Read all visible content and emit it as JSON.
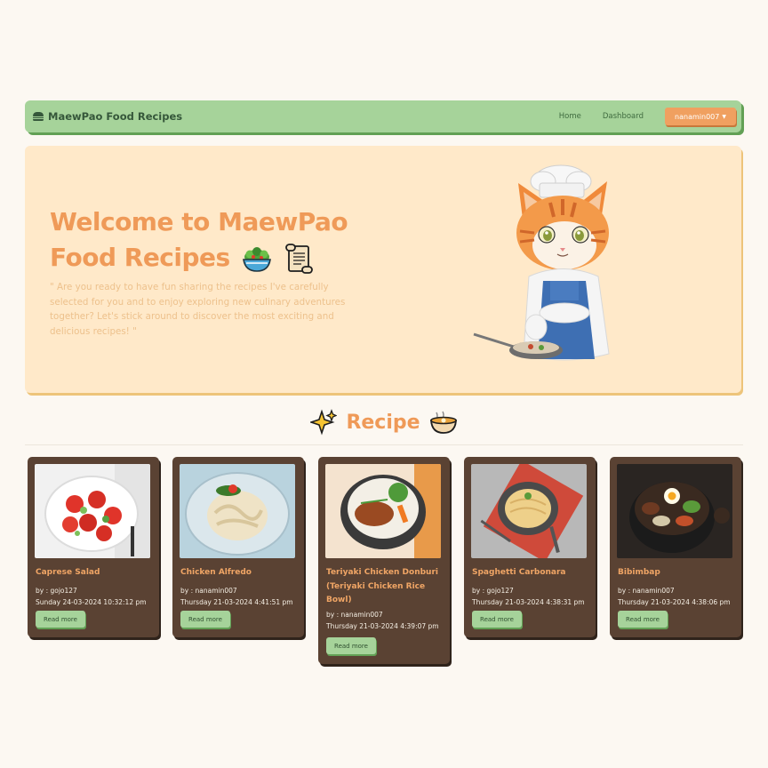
{
  "navbar": {
    "brand": "MaewPao Food Recipes",
    "links": [
      "Home",
      "Dashboard"
    ],
    "user": "nanamin007"
  },
  "hero": {
    "title_line1": "Welcome to MaewPao",
    "title_line2": "Food Recipes",
    "quote": "\" Are you ready to have fun sharing the recipes I've carefully selected for you and to enjoy exploring new culinary adventures together? Let's stick around to discover the most exciting and delicious recipes! \""
  },
  "section": {
    "title": "Recipe"
  },
  "recipes": [
    {
      "title": "Caprese Salad",
      "author": "by : gojo127",
      "date": "Sunday 24-03-2024 10:32:12 pm",
      "button": "Read more"
    },
    {
      "title": "Chicken Alfredo",
      "author": "by : nanamin007",
      "date": "Thursday 21-03-2024 4:41:51 pm",
      "button": "Read more"
    },
    {
      "title": "Teriyaki Chicken Donburi (Teriyaki Chicken Rice Bowl)",
      "author": "by : nanamin007",
      "date": "Thursday 21-03-2024 4:39:07 pm",
      "button": "Read more"
    },
    {
      "title": "Spaghetti Carbonara",
      "author": "by : gojo127",
      "date": "Thursday 21-03-2024 4:38:31 pm",
      "button": "Read more"
    },
    {
      "title": "Bibimbap",
      "author": "by : nanamin007",
      "date": "Thursday 21-03-2024 4:38:06 pm",
      "button": "Read more"
    }
  ],
  "colors": {
    "navbar": "#a6d39a",
    "accent_orange": "#ef9a58",
    "hero_bg": "#ffe9c9",
    "card_bg": "#5a4233",
    "page_bg": "#fcf8f2"
  }
}
